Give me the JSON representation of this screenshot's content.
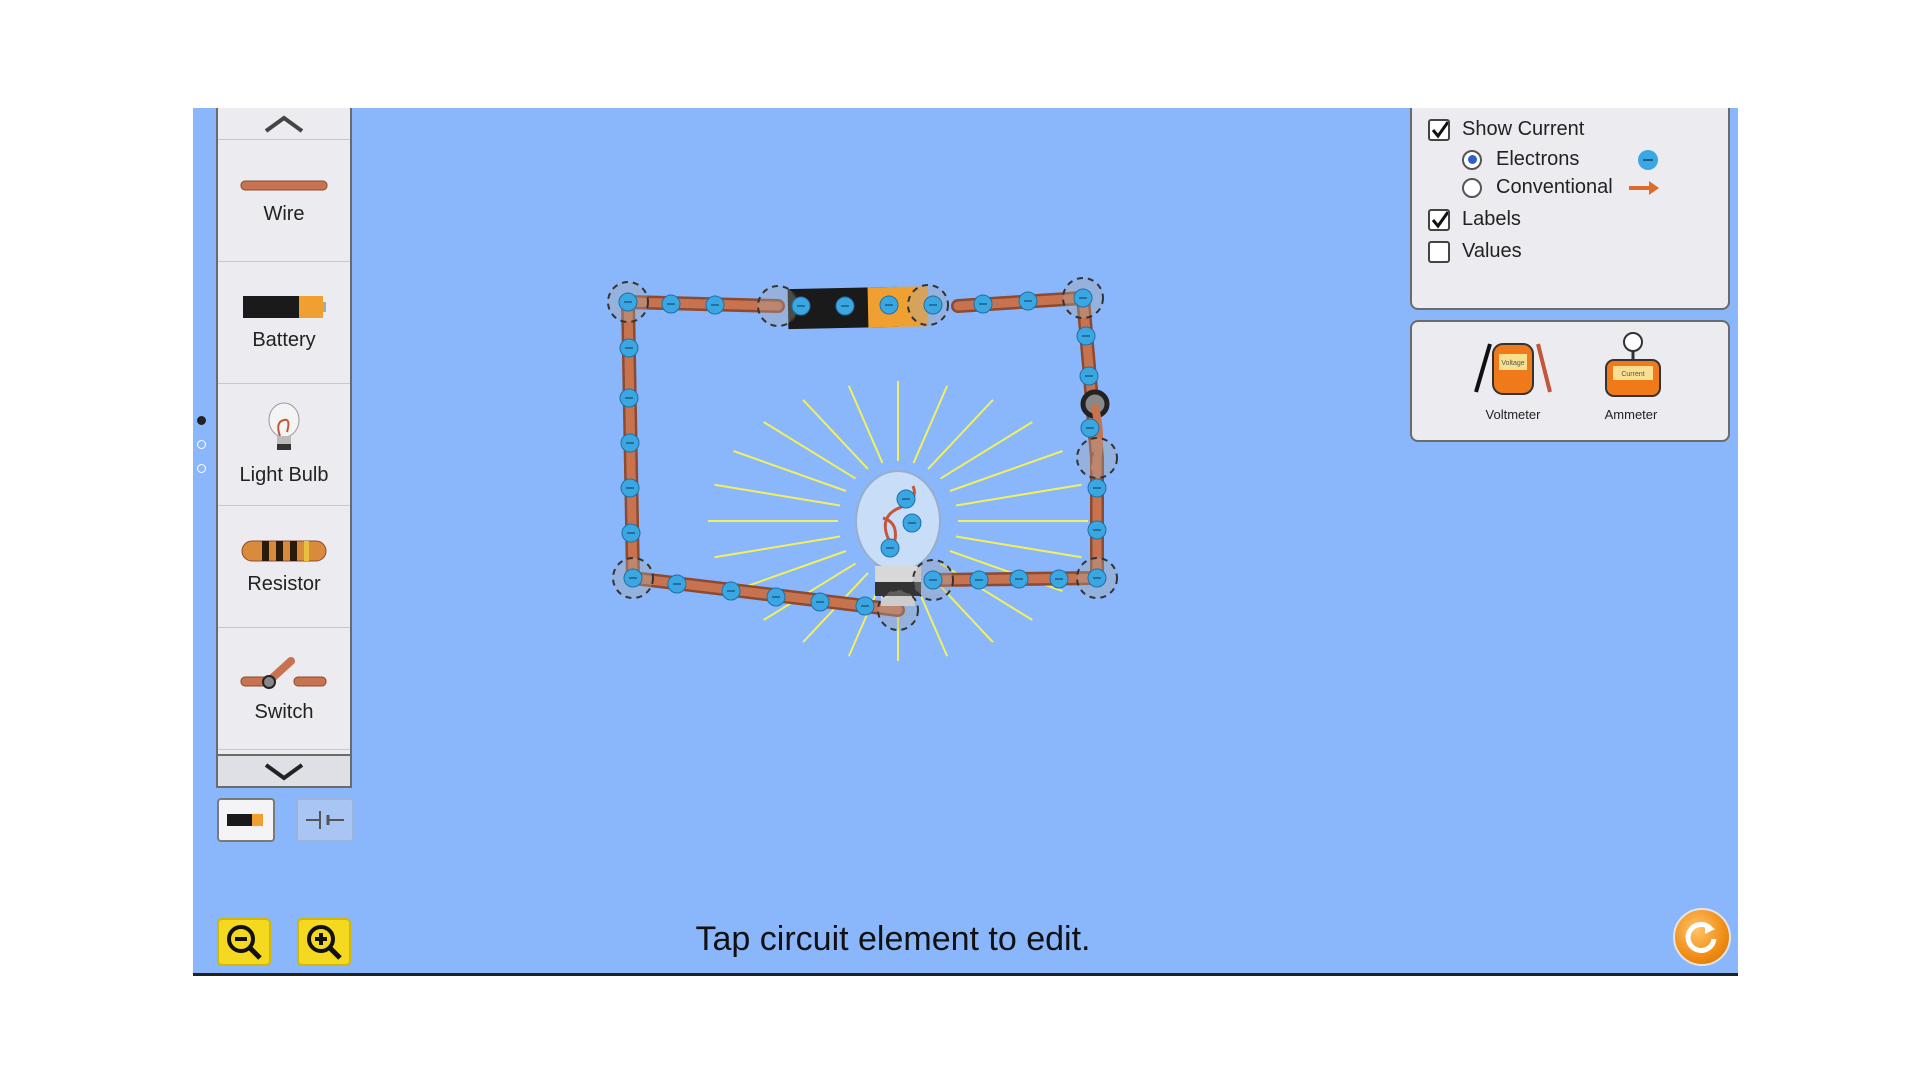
{
  "toolbox": {
    "items": [
      {
        "label": "Wire",
        "icon": "wire-icon"
      },
      {
        "label": "Battery",
        "icon": "battery-icon"
      },
      {
        "label": "Light Bulb",
        "icon": "light-bulb-icon"
      },
      {
        "label": "Resistor",
        "icon": "resistor-icon"
      },
      {
        "label": "Switch",
        "icon": "switch-icon"
      }
    ],
    "page_count": 3,
    "active_page": 1
  },
  "controls": {
    "show_current": {
      "label": "Show Current",
      "checked": true
    },
    "electrons": {
      "label": "Electrons",
      "selected": true
    },
    "conventional": {
      "label": "Conventional",
      "selected": false
    },
    "labels": {
      "label": "Labels",
      "checked": true
    },
    "values": {
      "label": "Values",
      "checked": false
    }
  },
  "meters": {
    "voltmeter": {
      "label": "Voltmeter",
      "face_text": "Voltage"
    },
    "ammeter": {
      "label": "Ammeter",
      "face_text": "Current"
    }
  },
  "status": "Tap circuit element to edit.",
  "colors": {
    "background": "#8ab6fb",
    "wire": "#c8734f",
    "electron": "#3aa7e3",
    "light_ray": "#f0f060",
    "zoom_button": "#f5d820",
    "reset_button": "#f08c14"
  }
}
